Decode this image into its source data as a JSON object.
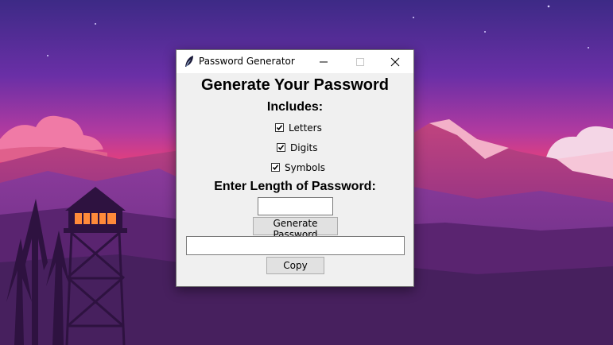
{
  "window": {
    "title": "Password Generator"
  },
  "app": {
    "heading": "Generate Your Password",
    "includes_label": "Includes:",
    "options": [
      {
        "label": "Letters",
        "checked": true
      },
      {
        "label": "Digits",
        "checked": true
      },
      {
        "label": "Symbols",
        "checked": true
      }
    ],
    "length_label": "Enter Length of Password:",
    "length_value": "",
    "generate_label": "Generate Password",
    "output_value": "",
    "copy_label": "Copy"
  },
  "desktop": {
    "wallpaper": "sunset mountains with fire lookout tower",
    "colors": {
      "sky_top": "#4a2a8a",
      "sky_mid": "#8a3aa8",
      "horizon": "#e2406a",
      "mountain": "#9a3a8a",
      "foreground": "#3a1a4a"
    }
  }
}
